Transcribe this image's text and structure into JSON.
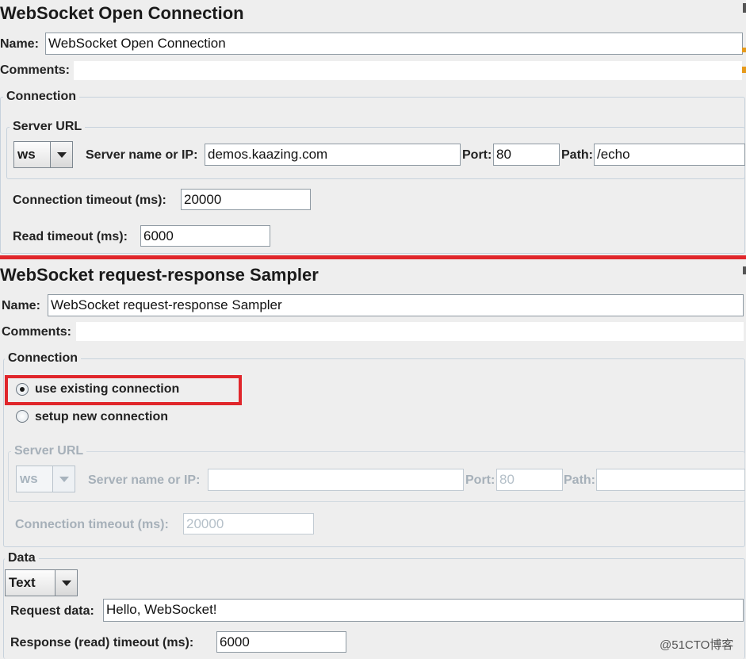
{
  "open_connection": {
    "title": "WebSocket Open Connection",
    "name_label": "Name:",
    "name_value": "WebSocket Open Connection",
    "comments_label": "Comments:",
    "connection_legend": "Connection",
    "server_url_legend": "Server URL",
    "protocol_value": "ws",
    "server_label": "Server name or IP:",
    "server_value": "demos.kaazing.com",
    "port_label": "Port:",
    "port_value": "80",
    "path_label": "Path:",
    "path_value": "/echo",
    "conn_timeout_label": "Connection timeout (ms):",
    "conn_timeout_value": "20000",
    "read_timeout_label": "Read timeout (ms):",
    "read_timeout_value": "6000"
  },
  "request_response": {
    "title": "WebSocket request-response Sampler",
    "name_label": "Name:",
    "name_value": "WebSocket request-response Sampler",
    "comments_label": "Comments:",
    "connection_legend": "Connection",
    "radio_existing": "use existing connection",
    "radio_new": "setup new connection",
    "server_url_legend": "Server URL",
    "protocol_value": "ws",
    "server_label": "Server name or IP:",
    "server_value": "",
    "port_label": "Port:",
    "port_value": "80",
    "path_label": "Path:",
    "path_value": "",
    "conn_timeout_label": "Connection timeout (ms):",
    "conn_timeout_value": "20000",
    "data_legend": "Data",
    "data_type_value": "Text",
    "request_data_label": "Request data:",
    "request_data_value": "Hello, WebSocket!",
    "response_timeout_label": "Response (read) timeout (ms):",
    "response_timeout_value": "6000"
  },
  "watermark": "@51CTO博客",
  "colors": {
    "highlight": "#e0262b",
    "panel_bg": "#eeeeee",
    "disabled_text": "#a6b0b9"
  }
}
